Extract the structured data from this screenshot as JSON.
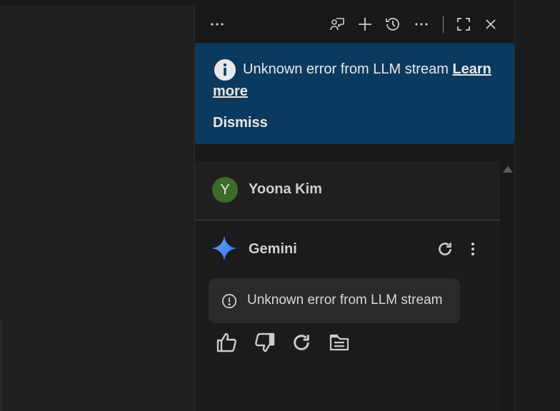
{
  "toolbar": {
    "icons": [
      "more-horizontal-icon",
      "chat-feedback-icon",
      "plus-icon",
      "history-icon",
      "more-horizontal-icon",
      "fullscreen-icon",
      "close-icon"
    ]
  },
  "banner": {
    "message": "Unknown error from LLM stream",
    "link_label": "Learn more",
    "dismiss_label": "Dismiss",
    "background": "#0c3a5e"
  },
  "user": {
    "initial": "Y",
    "name": "Yoona Kim",
    "avatar_color": "#3d6b2a"
  },
  "assistant": {
    "name": "Gemini",
    "error_message": "Unknown error from LLM stream",
    "actions": [
      "thumbs-up-icon",
      "thumbs-down-icon",
      "regenerate-icon",
      "copy-icon"
    ]
  },
  "colors": {
    "panel_bg": "#181818",
    "text": "#cccccc",
    "gemini_blue": "#4b8cf5"
  }
}
